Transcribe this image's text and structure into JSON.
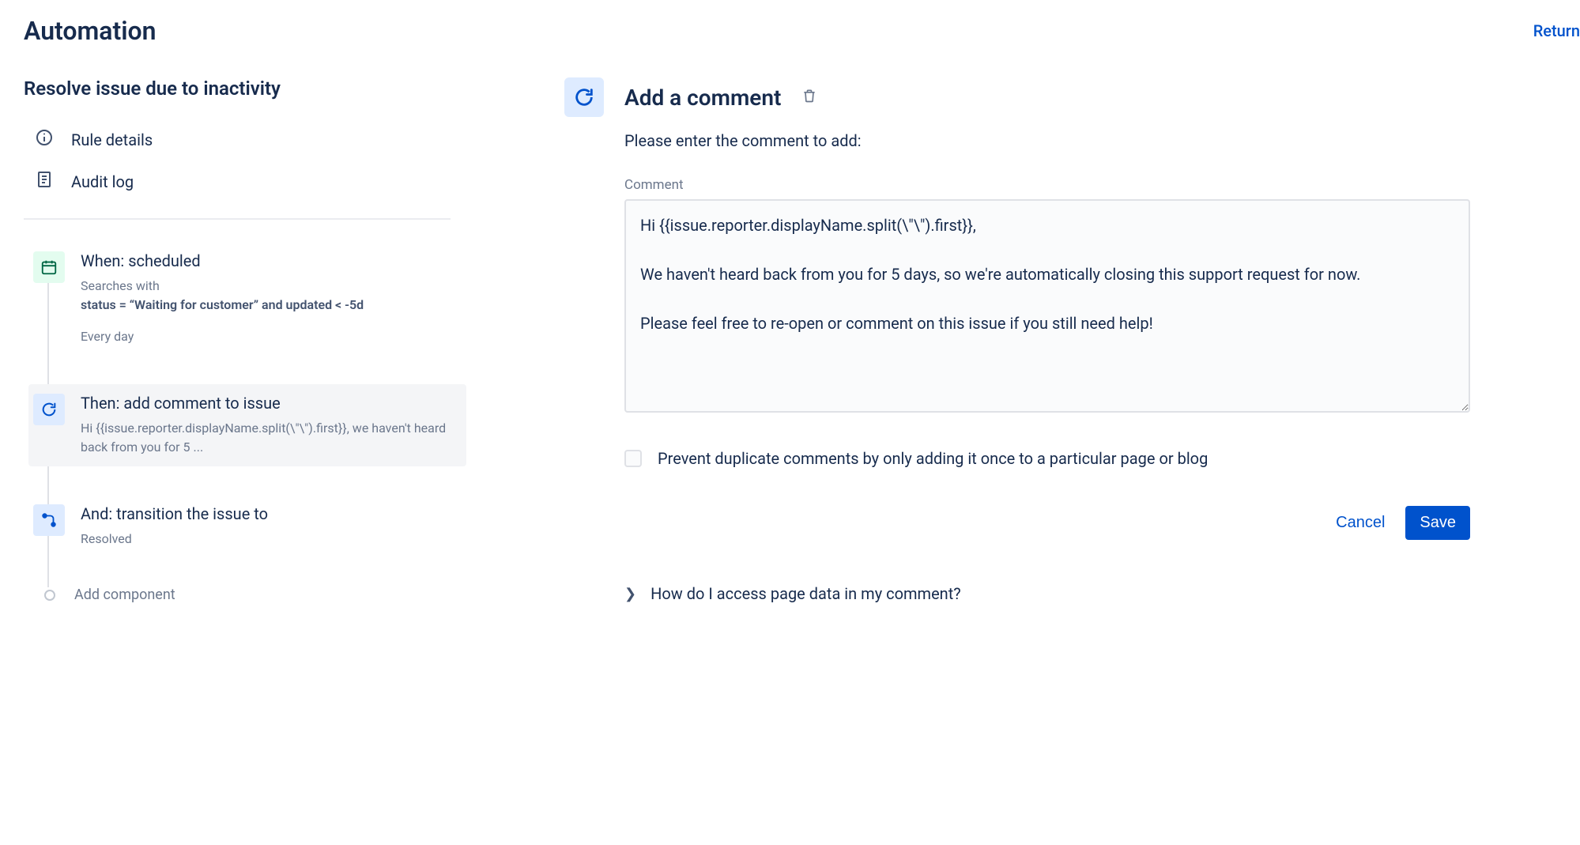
{
  "header": {
    "title": "Automation",
    "return_label": "Return"
  },
  "sidebar": {
    "rule_name": "Resolve issue due to inactivity",
    "nav": {
      "rule_details": "Rule details",
      "audit_log": "Audit log"
    },
    "steps": {
      "when": {
        "title": "When: scheduled",
        "search_prefix": "Searches with",
        "search_jql": "status = “Waiting for customer” and updated < -5d",
        "schedule": "Every day"
      },
      "then": {
        "title": "Then: add comment to issue",
        "preview": "Hi {{issue.reporter.displayName.split(\\\"\\\").first}}, we haven't heard back from you for 5 ..."
      },
      "and": {
        "title": "And: transition the issue to",
        "status": "Resolved"
      }
    },
    "add_component_label": "Add component"
  },
  "panel": {
    "title": "Add a comment",
    "subtitle": "Please enter the comment to add:",
    "comment_label": "Comment",
    "comment_value": "Hi {{issue.reporter.displayName.split(\\\"\\\").first}},\n\nWe haven't heard back from you for 5 days, so we're automatically closing this support request for now.\n\nPlease feel free to re-open or comment on this issue if you still need help!",
    "prevent_dup_label": "Prevent duplicate comments by only adding it once to a particular page or blog",
    "cancel_label": "Cancel",
    "save_label": "Save",
    "help_label": "How do I access page data in my comment?"
  }
}
